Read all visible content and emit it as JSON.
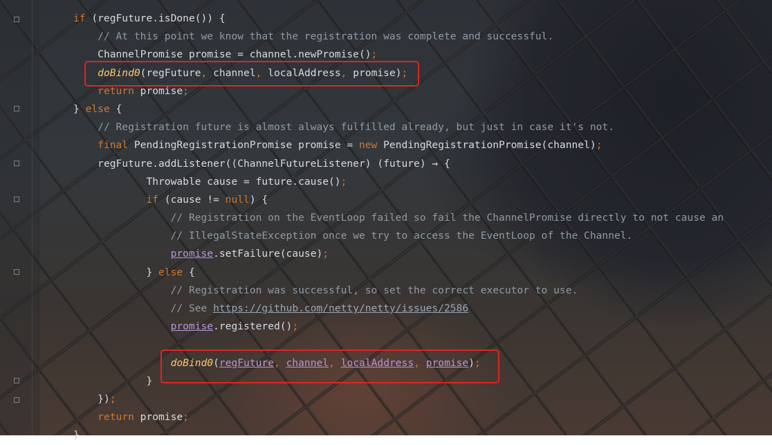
{
  "editor": {
    "lines": [
      {
        "indent": 0,
        "parts": [
          {
            "t": "kw",
            "v": "if"
          },
          {
            "t": "",
            "v": " (regFuture.isDone()) {"
          }
        ]
      },
      {
        "indent": 1,
        "parts": [
          {
            "t": "cm",
            "v": "// At this point we know that the registration was complete and successful."
          }
        ]
      },
      {
        "indent": 1,
        "parts": [
          {
            "t": "",
            "v": "ChannelPromise promise = channel.newPromise()"
          },
          {
            "t": "punc",
            "v": ";"
          }
        ]
      },
      {
        "indent": 1,
        "parts": [
          {
            "t": "fn",
            "v": "doBind0"
          },
          {
            "t": "",
            "v": "(regFuture"
          },
          {
            "t": "punc",
            "v": ","
          },
          {
            "t": "",
            "v": " channel"
          },
          {
            "t": "punc",
            "v": ","
          },
          {
            "t": "",
            "v": " localAddress"
          },
          {
            "t": "punc",
            "v": ","
          },
          {
            "t": "",
            "v": " promise)"
          },
          {
            "t": "punc",
            "v": ";"
          }
        ]
      },
      {
        "indent": 1,
        "parts": [
          {
            "t": "kw",
            "v": "return"
          },
          {
            "t": "",
            "v": " promise"
          },
          {
            "t": "punc",
            "v": ";"
          }
        ]
      },
      {
        "indent": 0,
        "parts": [
          {
            "t": "",
            "v": "} "
          },
          {
            "t": "kw",
            "v": "else"
          },
          {
            "t": "",
            "v": " {"
          }
        ]
      },
      {
        "indent": 1,
        "parts": [
          {
            "t": "cm",
            "v": "// Registration future is almost always fulfilled already, but just in case it's not."
          }
        ]
      },
      {
        "indent": 1,
        "parts": [
          {
            "t": "kw",
            "v": "final"
          },
          {
            "t": "",
            "v": " PendingRegistrationPromise promise = "
          },
          {
            "t": "kw",
            "v": "new"
          },
          {
            "t": "",
            "v": " PendingRegistrationPromise(channel)"
          },
          {
            "t": "punc",
            "v": ";"
          }
        ]
      },
      {
        "indent": 1,
        "parts": [
          {
            "t": "",
            "v": "regFuture.addListener((ChannelFutureListener) (future) → {"
          }
        ]
      },
      {
        "indent": 3,
        "parts": [
          {
            "t": "",
            "v": "Throwable cause = future.cause()"
          },
          {
            "t": "punc",
            "v": ";"
          }
        ]
      },
      {
        "indent": 3,
        "parts": [
          {
            "t": "kw",
            "v": "if"
          },
          {
            "t": "",
            "v": " (cause != "
          },
          {
            "t": "kw",
            "v": "null"
          },
          {
            "t": "",
            "v": ") {"
          }
        ]
      },
      {
        "indent": 4,
        "parts": [
          {
            "t": "cm",
            "v": "// Registration on the EventLoop failed so fail the ChannelPromise directly to not cause an"
          }
        ]
      },
      {
        "indent": 4,
        "parts": [
          {
            "t": "cm",
            "v": "// IllegalStateException once we try to access the EventLoop of the Channel."
          }
        ]
      },
      {
        "indent": 4,
        "parts": [
          {
            "t": "field",
            "v": "promise"
          },
          {
            "t": "",
            "v": ".setFailure(cause)"
          },
          {
            "t": "punc",
            "v": ";"
          }
        ]
      },
      {
        "indent": 3,
        "parts": [
          {
            "t": "",
            "v": "} "
          },
          {
            "t": "kw",
            "v": "else"
          },
          {
            "t": "",
            "v": " {"
          }
        ]
      },
      {
        "indent": 4,
        "parts": [
          {
            "t": "cm",
            "v": "// Registration was successful, so set the correct executor to use."
          }
        ]
      },
      {
        "indent": 4,
        "parts": [
          {
            "t": "cm",
            "v": "// See "
          },
          {
            "t": "link",
            "v": "https://github.com/netty/netty/issues/2586"
          }
        ]
      },
      {
        "indent": 4,
        "parts": [
          {
            "t": "field",
            "v": "promise"
          },
          {
            "t": "",
            "v": ".registered()"
          },
          {
            "t": "punc",
            "v": ";"
          }
        ]
      },
      {
        "indent": 0,
        "parts": []
      },
      {
        "indent": 4,
        "parts": [
          {
            "t": "fn",
            "v": "doBind0"
          },
          {
            "t": "",
            "v": "("
          },
          {
            "t": "field",
            "v": "regFuture"
          },
          {
            "t": "punc",
            "v": ","
          },
          {
            "t": "",
            "v": " "
          },
          {
            "t": "field",
            "v": "channel"
          },
          {
            "t": "punc",
            "v": ","
          },
          {
            "t": "",
            "v": " "
          },
          {
            "t": "field",
            "v": "localAddress"
          },
          {
            "t": "punc",
            "v": ","
          },
          {
            "t": "",
            "v": " "
          },
          {
            "t": "field",
            "v": "promise"
          },
          {
            "t": "",
            "v": ")"
          },
          {
            "t": "punc",
            "v": ";"
          }
        ]
      },
      {
        "indent": 3,
        "parts": [
          {
            "t": "",
            "v": "}"
          }
        ]
      },
      {
        "indent": 1,
        "parts": [
          {
            "t": "",
            "v": "})"
          },
          {
            "t": "punc",
            "v": ";"
          }
        ]
      },
      {
        "indent": 1,
        "parts": [
          {
            "t": "kw",
            "v": "return"
          },
          {
            "t": "",
            "v": " promise"
          },
          {
            "t": "punc",
            "v": ";"
          }
        ]
      },
      {
        "indent": 0,
        "parts": [
          {
            "t": "",
            "v": "}"
          }
        ]
      }
    ]
  },
  "colors": {
    "keyword": "#cc7832",
    "comment": "#8f9aa3",
    "method_italic": "#ffc66d",
    "field_underlined": "#b596d8",
    "highlight_box": "#e02424"
  },
  "annotations": [
    "highlight-box-first-dobind0",
    "highlight-box-second-dobind0"
  ]
}
